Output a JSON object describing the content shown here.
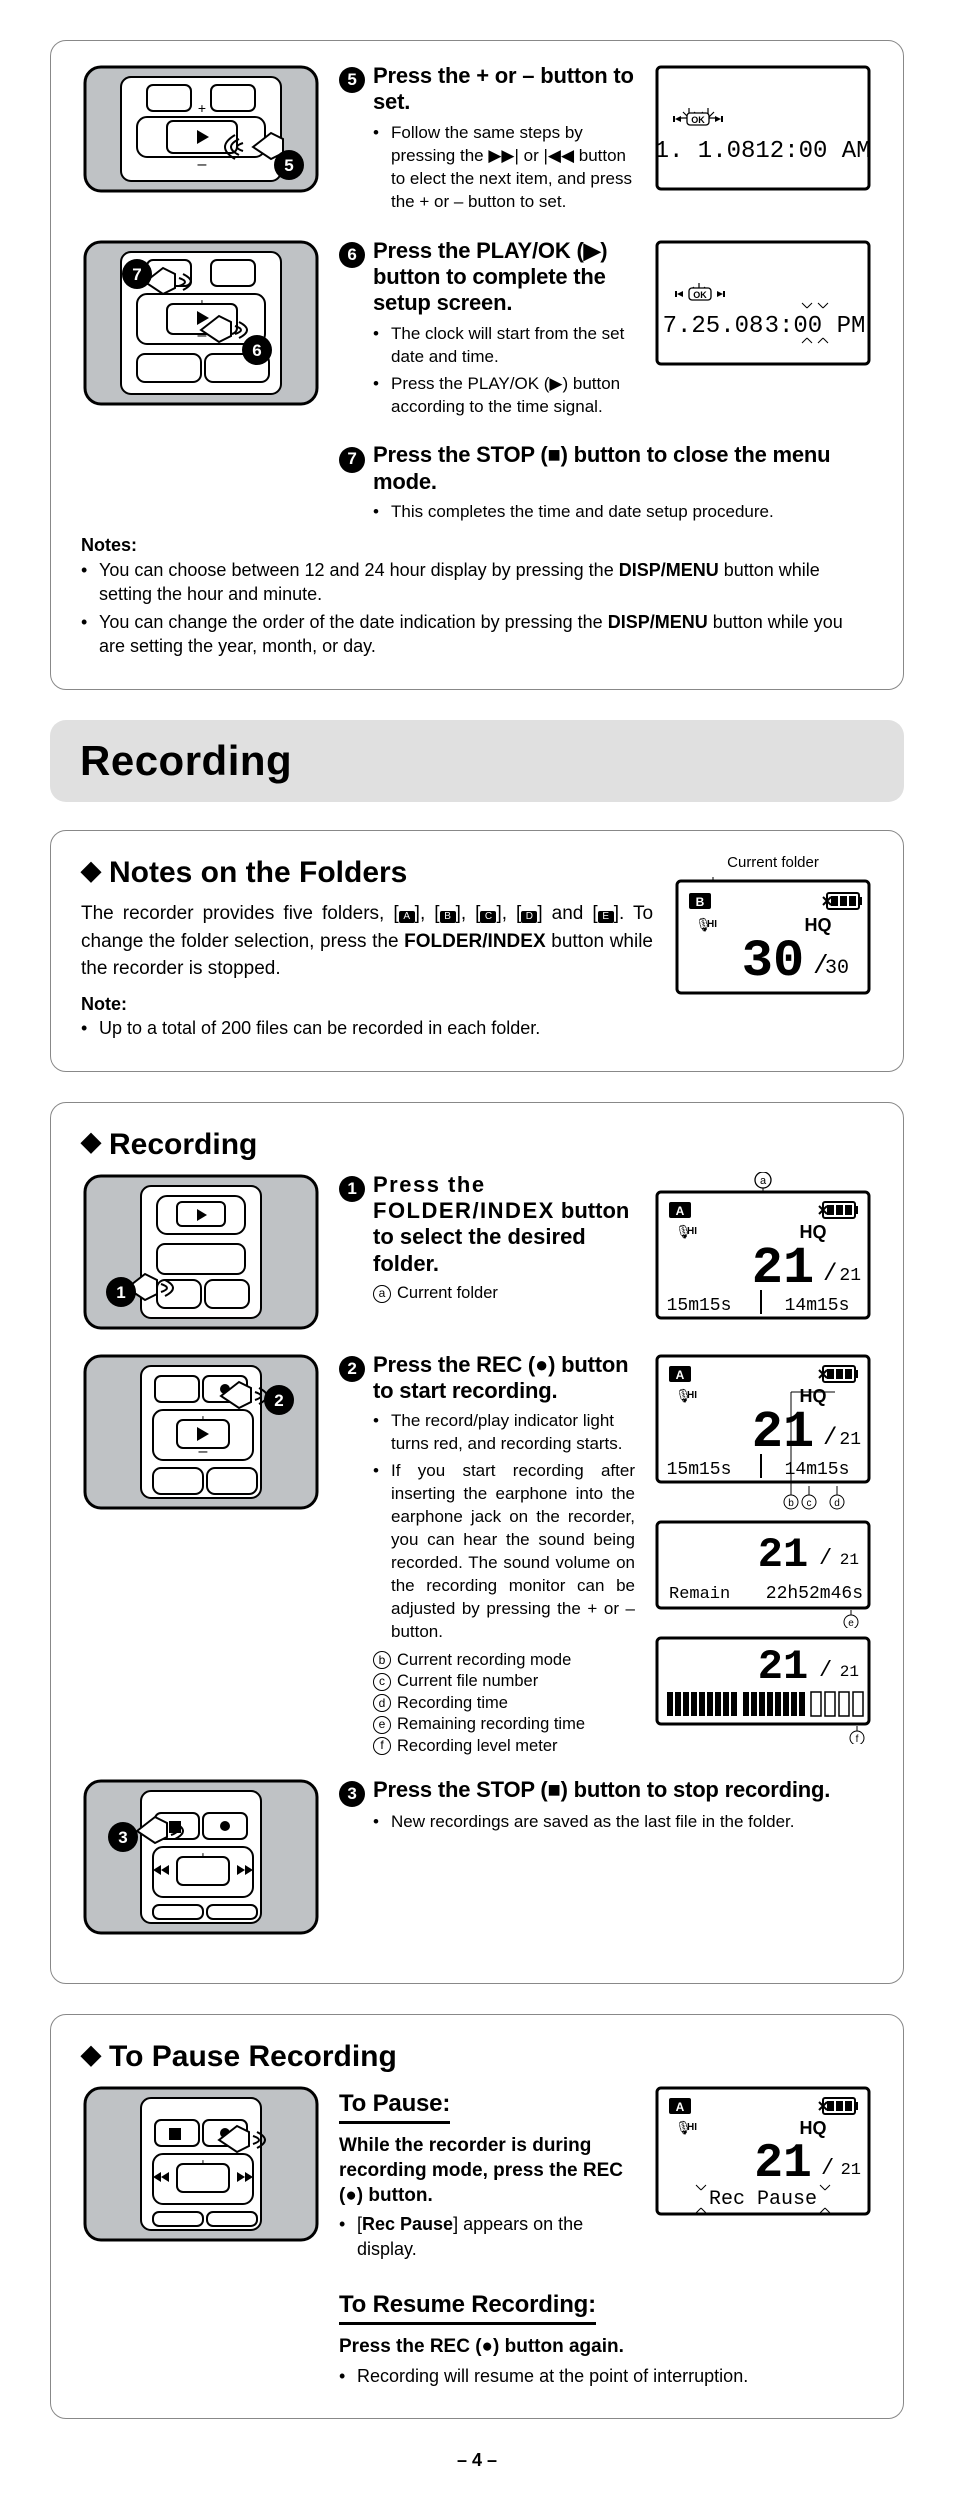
{
  "setup": {
    "step5": {
      "title_a": "Press the",
      "plus": "+",
      "title_b": "or",
      "minus": "–",
      "title_c": "button to set.",
      "bullets": [
        "Follow the same steps by pressing the ▶▶| or |◀◀ button to elect the next item, and press the + or – button to set."
      ],
      "lcd": {
        "date": "1.  1.08",
        "time": "12:00 AM"
      }
    },
    "step6": {
      "title": "Press the PLAY/OK (▶) button to complete the setup screen.",
      "bullets": [
        "The clock will start from the set date and time.",
        "Press the PLAY/OK (▶) button according to the time signal."
      ],
      "lcd": {
        "date": "7.25.08",
        "time": "3:00 PM"
      }
    },
    "step7": {
      "title": "Press the STOP (■) button to close the menu mode.",
      "bullets": [
        "This completes the time and date setup procedure."
      ]
    },
    "notes_label": "Notes:",
    "notes": [
      "You can choose between 12 and 24 hour display by pressing the DISP/MENU button while setting the hour and minute.",
      "You can change the order of the date indication by pressing the DISP/MENU button while you are setting the year, month, or day."
    ]
  },
  "h_recording": "Recording",
  "folders": {
    "heading": "Notes on the Folders",
    "intro_a": "The recorder provides five folders, [",
    "intro_b": "], [",
    "intro_c": "] and [",
    "intro_d": "]. To change the folder selection, press the ",
    "folder_index": "FOLDER/INDEX",
    "intro_e": " button while the recorder is stopped.",
    "note_label": "Note:",
    "note": "Up to a total of 200 files can be recorded in each folder.",
    "current_folder_label": "Current folder",
    "lcd": {
      "folder": "B",
      "hq": "HQ",
      "big": "30",
      "total": "30"
    }
  },
  "rec": {
    "heading": "Recording",
    "step1": {
      "title_a": "Press the ",
      "title_b": "FOLDER/INDEX",
      "title_c": " button to select the desired folder.",
      "a_label": "Current folder",
      "lcd": {
        "folder": "A",
        "hq": "HQ",
        "big": "21",
        "total": "21",
        "left": "15m15s",
        "right": "14m15s"
      }
    },
    "step2": {
      "title": "Press the REC (●) button to start recording.",
      "bullets": [
        "The record/play indicator light turns red, and recording starts.",
        "If you start recording after inserting the earphone into the earphone jack on the recorder, you can hear the sound being recorded. The sound volume on the recording monitor can be adjusted by pressing the + or – button."
      ],
      "annot": {
        "b": "Current recording mode",
        "c": "Current file number",
        "d": "Recording time",
        "e": "Remaining recording time",
        "f": "Recording level meter"
      },
      "lcd1": {
        "folder": "A",
        "hq": "HQ",
        "big": "21",
        "total": "21",
        "left": "15m15s",
        "right": "14m15s"
      },
      "lcd2": {
        "big": "21",
        "total": "21",
        "remain_label": "Remain",
        "remain": "22h52m46s"
      },
      "lcd3": {
        "big": "21",
        "total": "21"
      }
    },
    "step3": {
      "title": "Press the STOP (■) button to stop recording.",
      "bullets": [
        "New recordings are saved as the last file in the folder."
      ]
    }
  },
  "pause": {
    "heading": "To Pause Recording",
    "to_pause": "To Pause:",
    "lead": "While the recorder is during recording mode, press the REC (●) button.",
    "bullet1_a": "[",
    "bullet1_b": "Rec Pause",
    "bullet1_c": "] appears on the display.",
    "to_resume": "To Resume Recording:",
    "lead2": "Press the REC (●) button again.",
    "bullet2": "Recording will resume at the point of interruption.",
    "lcd": {
      "folder": "A",
      "hq": "HQ",
      "big": "21",
      "total": "21",
      "pause": "Rec Pause"
    }
  },
  "page_num": "4"
}
